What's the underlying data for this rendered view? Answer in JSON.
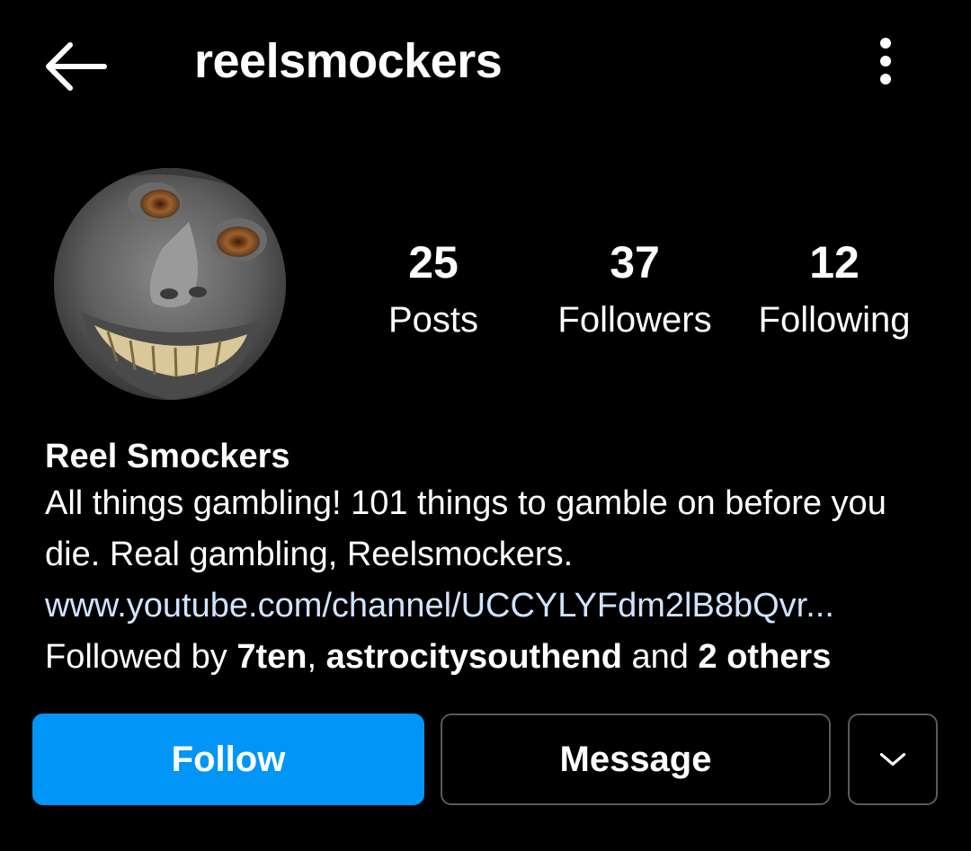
{
  "header": {
    "username": "reelsmockers",
    "back_icon": "arrow-left-icon",
    "more_icon": "more-vertical-icon"
  },
  "profile": {
    "avatar_icon": "profile-avatar",
    "stats": {
      "posts": {
        "count": "25",
        "label": "Posts"
      },
      "followers": {
        "count": "37",
        "label": "Followers"
      },
      "following": {
        "count": "12",
        "label": "Following"
      }
    },
    "display_name": "Reel Smockers",
    "bio": "All things gambling! 101 things to gamble on before you die. Real gambling, Reelsmockers.",
    "link": "www.youtube.com/channel/UCCYLYFdm2lB8bQvr...",
    "followed_by": {
      "prefix": "Followed by ",
      "user1": "7ten",
      "sep": ", ",
      "user2": "astrocitysouthend",
      "and": " and ",
      "others": "2 others"
    }
  },
  "actions": {
    "follow_label": "Follow",
    "message_label": "Message",
    "dropdown_icon": "chevron-down-icon"
  },
  "colors": {
    "background": "#000000",
    "follow_button": "#0095f6",
    "link": "#d0e4ff",
    "button_border": "#5a5a5a"
  }
}
